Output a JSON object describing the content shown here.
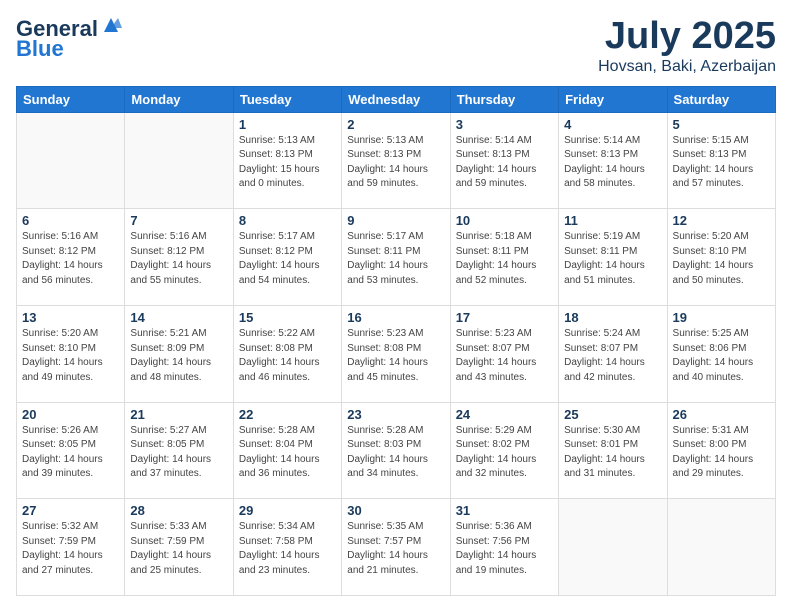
{
  "logo": {
    "general": "General",
    "blue": "Blue"
  },
  "header": {
    "month": "July 2025",
    "location": "Hovsan, Baki, Azerbaijan"
  },
  "weekdays": [
    "Sunday",
    "Monday",
    "Tuesday",
    "Wednesday",
    "Thursday",
    "Friday",
    "Saturday"
  ],
  "weeks": [
    [
      {
        "day": "",
        "info": ""
      },
      {
        "day": "",
        "info": ""
      },
      {
        "day": "1",
        "info": "Sunrise: 5:13 AM\nSunset: 8:13 PM\nDaylight: 15 hours\nand 0 minutes."
      },
      {
        "day": "2",
        "info": "Sunrise: 5:13 AM\nSunset: 8:13 PM\nDaylight: 14 hours\nand 59 minutes."
      },
      {
        "day": "3",
        "info": "Sunrise: 5:14 AM\nSunset: 8:13 PM\nDaylight: 14 hours\nand 59 minutes."
      },
      {
        "day": "4",
        "info": "Sunrise: 5:14 AM\nSunset: 8:13 PM\nDaylight: 14 hours\nand 58 minutes."
      },
      {
        "day": "5",
        "info": "Sunrise: 5:15 AM\nSunset: 8:13 PM\nDaylight: 14 hours\nand 57 minutes."
      }
    ],
    [
      {
        "day": "6",
        "info": "Sunrise: 5:16 AM\nSunset: 8:12 PM\nDaylight: 14 hours\nand 56 minutes."
      },
      {
        "day": "7",
        "info": "Sunrise: 5:16 AM\nSunset: 8:12 PM\nDaylight: 14 hours\nand 55 minutes."
      },
      {
        "day": "8",
        "info": "Sunrise: 5:17 AM\nSunset: 8:12 PM\nDaylight: 14 hours\nand 54 minutes."
      },
      {
        "day": "9",
        "info": "Sunrise: 5:17 AM\nSunset: 8:11 PM\nDaylight: 14 hours\nand 53 minutes."
      },
      {
        "day": "10",
        "info": "Sunrise: 5:18 AM\nSunset: 8:11 PM\nDaylight: 14 hours\nand 52 minutes."
      },
      {
        "day": "11",
        "info": "Sunrise: 5:19 AM\nSunset: 8:11 PM\nDaylight: 14 hours\nand 51 minutes."
      },
      {
        "day": "12",
        "info": "Sunrise: 5:20 AM\nSunset: 8:10 PM\nDaylight: 14 hours\nand 50 minutes."
      }
    ],
    [
      {
        "day": "13",
        "info": "Sunrise: 5:20 AM\nSunset: 8:10 PM\nDaylight: 14 hours\nand 49 minutes."
      },
      {
        "day": "14",
        "info": "Sunrise: 5:21 AM\nSunset: 8:09 PM\nDaylight: 14 hours\nand 48 minutes."
      },
      {
        "day": "15",
        "info": "Sunrise: 5:22 AM\nSunset: 8:08 PM\nDaylight: 14 hours\nand 46 minutes."
      },
      {
        "day": "16",
        "info": "Sunrise: 5:23 AM\nSunset: 8:08 PM\nDaylight: 14 hours\nand 45 minutes."
      },
      {
        "day": "17",
        "info": "Sunrise: 5:23 AM\nSunset: 8:07 PM\nDaylight: 14 hours\nand 43 minutes."
      },
      {
        "day": "18",
        "info": "Sunrise: 5:24 AM\nSunset: 8:07 PM\nDaylight: 14 hours\nand 42 minutes."
      },
      {
        "day": "19",
        "info": "Sunrise: 5:25 AM\nSunset: 8:06 PM\nDaylight: 14 hours\nand 40 minutes."
      }
    ],
    [
      {
        "day": "20",
        "info": "Sunrise: 5:26 AM\nSunset: 8:05 PM\nDaylight: 14 hours\nand 39 minutes."
      },
      {
        "day": "21",
        "info": "Sunrise: 5:27 AM\nSunset: 8:05 PM\nDaylight: 14 hours\nand 37 minutes."
      },
      {
        "day": "22",
        "info": "Sunrise: 5:28 AM\nSunset: 8:04 PM\nDaylight: 14 hours\nand 36 minutes."
      },
      {
        "day": "23",
        "info": "Sunrise: 5:28 AM\nSunset: 8:03 PM\nDaylight: 14 hours\nand 34 minutes."
      },
      {
        "day": "24",
        "info": "Sunrise: 5:29 AM\nSunset: 8:02 PM\nDaylight: 14 hours\nand 32 minutes."
      },
      {
        "day": "25",
        "info": "Sunrise: 5:30 AM\nSunset: 8:01 PM\nDaylight: 14 hours\nand 31 minutes."
      },
      {
        "day": "26",
        "info": "Sunrise: 5:31 AM\nSunset: 8:00 PM\nDaylight: 14 hours\nand 29 minutes."
      }
    ],
    [
      {
        "day": "27",
        "info": "Sunrise: 5:32 AM\nSunset: 7:59 PM\nDaylight: 14 hours\nand 27 minutes."
      },
      {
        "day": "28",
        "info": "Sunrise: 5:33 AM\nSunset: 7:59 PM\nDaylight: 14 hours\nand 25 minutes."
      },
      {
        "day": "29",
        "info": "Sunrise: 5:34 AM\nSunset: 7:58 PM\nDaylight: 14 hours\nand 23 minutes."
      },
      {
        "day": "30",
        "info": "Sunrise: 5:35 AM\nSunset: 7:57 PM\nDaylight: 14 hours\nand 21 minutes."
      },
      {
        "day": "31",
        "info": "Sunrise: 5:36 AM\nSunset: 7:56 PM\nDaylight: 14 hours\nand 19 minutes."
      },
      {
        "day": "",
        "info": ""
      },
      {
        "day": "",
        "info": ""
      }
    ]
  ]
}
